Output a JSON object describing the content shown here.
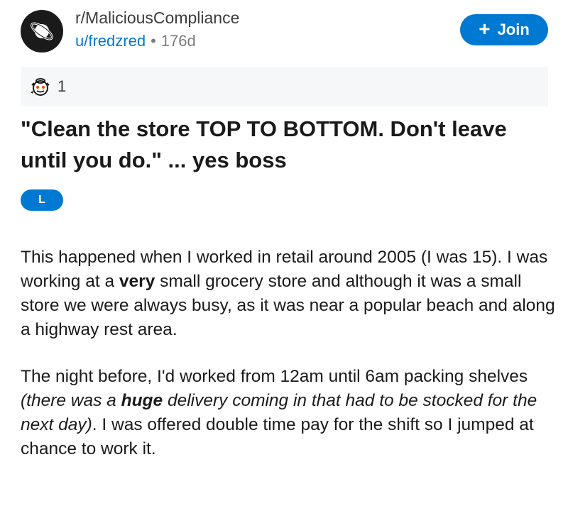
{
  "post": {
    "subreddit": "r/MaliciousCompliance",
    "author": "u/fredzred",
    "separator": "•",
    "age": "176d",
    "join_plus": "+",
    "join_label": "Join",
    "award_count": "1",
    "award_icon": "award-icon",
    "subreddit_icon": "saturn-planet-icon",
    "title": "\"Clean the store TOP TO BOTTOM. Don't leave until you do.\" ... yes boss",
    "flair": "L"
  },
  "body": {
    "p1": {
      "a": "This happened when I worked in retail around 2005 (I was 15). I was working at a ",
      "b": "very",
      "c": " small grocery store and although it was a small store we were always busy, as it was near a popular beach and along a highway rest area."
    },
    "p2": {
      "a": "The night before, I'd worked from 12am until 6am packing shelves ",
      "i1": "(there was a ",
      "i2": "huge",
      "i3": " delivery coming in that had to be stocked for the next day)",
      "c": ". I was offered double time pay for the shift so I jumped at chance to work it."
    }
  },
  "colors": {
    "accent": "#0079d3",
    "text": "#1a1a1b",
    "muted": "#7c7c7c",
    "award_bar_bg": "#f6f7f8"
  }
}
